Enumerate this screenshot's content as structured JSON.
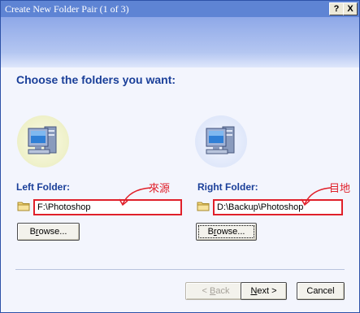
{
  "window": {
    "title": "Create New Folder Pair (1 of 3)",
    "help_glyph": "?",
    "close_glyph": "X"
  },
  "wizard": {
    "heading": "Choose the folders you want:"
  },
  "left": {
    "label": "Left Folder:",
    "value": "F:\\Photoshop",
    "browse_prefix": "B",
    "browse_underlined": "r",
    "browse_suffix": "owse...",
    "annotation": "來源"
  },
  "right": {
    "label": "Right Folder:",
    "value": "D:\\Backup\\Photoshop",
    "browse_prefix": "B",
    "browse_underlined": "r",
    "browse_suffix": "owse...",
    "annotation": "目地"
  },
  "footer": {
    "back_prefix": "< ",
    "back_underlined": "B",
    "back_suffix": "ack",
    "next_underlined": "N",
    "next_suffix": "ext >",
    "cancel": "Cancel"
  },
  "colors": {
    "accent": "#1a3f99",
    "annotation_red": "#e0202a",
    "banner": "#8ea8e8"
  },
  "icons": [
    "computer-icon",
    "folder-icon",
    "help-icon",
    "close-icon"
  ]
}
